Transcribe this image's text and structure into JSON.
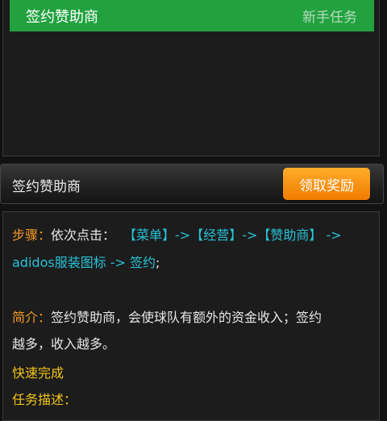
{
  "task_list": {
    "selected_task": {
      "name": "签约赞助商",
      "type": "新手任务"
    }
  },
  "header": {
    "title": "签约赞助商",
    "claim_button": "领取奖励"
  },
  "details": {
    "steps_label": "步骤：",
    "steps_intro": "依次点击：",
    "steps_path_1": "【菜单】->【经营】->【赞助商】 ->",
    "steps_path_2": "adidos服装图标 -> 签约",
    "steps_end": ";",
    "intro_label": "简介：",
    "intro_text_1": "签约赞助商，会使球队有额外的资金收入；签约",
    "intro_text_2": "越多，收入越多。",
    "quick_complete": "快速完成",
    "task_desc_label": "任务描述："
  },
  "colors": {
    "selected_row": "#21a23f",
    "claim_button": "#f58a0e",
    "label_orange": "#f49a20",
    "path_cyan": "#27c2d6",
    "quick_yellow": "#f2c418"
  }
}
